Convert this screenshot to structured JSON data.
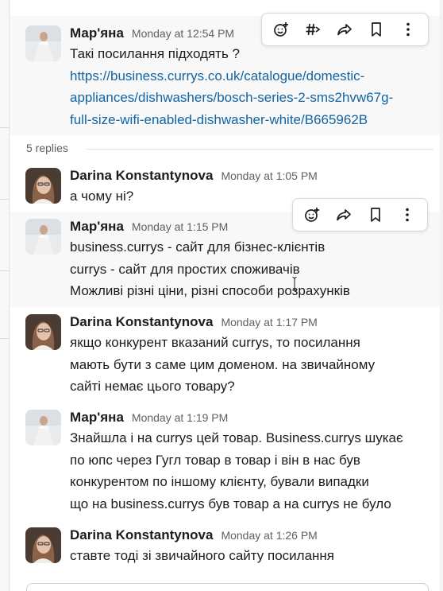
{
  "toolbar_top": {
    "actions": [
      {
        "icon": "add-reaction-icon"
      },
      {
        "icon": "hashtag-forward-icon"
      },
      {
        "icon": "share-forward-icon"
      },
      {
        "icon": "bookmark-icon"
      },
      {
        "icon": "more-vertical-icon"
      }
    ]
  },
  "toolbar_hover": {
    "actions": [
      {
        "icon": "add-reaction-icon"
      },
      {
        "icon": "share-forward-icon"
      },
      {
        "icon": "bookmark-icon"
      },
      {
        "icon": "more-vertical-icon"
      }
    ]
  },
  "parent": {
    "author": "Мар'яна",
    "time": "Monday at 12:54 PM",
    "lines": [
      "Такі посилання підходять ?"
    ],
    "link_lines": [
      "https://business.currys.co.uk/catalogue/domestic-",
      "appliances/dishwashers/bosch-series-2-sms2hvw67g-",
      "full-size-wifi-enabled-dishwasher-white/B665962B"
    ]
  },
  "replies_label": "5 replies",
  "messages": [
    {
      "author": "Darina Konstantynova",
      "time": "Monday at 1:05 PM",
      "lines": [
        "а чому ні?"
      ]
    },
    {
      "author": "Мар'яна",
      "time": "Monday at 1:15 PM",
      "lines": [
        "business.currys - сайт для бізнес-клієнтів",
        "currys - сайт для простих споживачів",
        "Можливі різні ціни, різні способи розрахунків"
      ]
    },
    {
      "author": "Darina Konstantynova",
      "time": "Monday at 1:17 PM",
      "lines": [
        "якщо конкурент вказаний currys, то посилання",
        "мають бути з саме цим доменом. на звичайному",
        "сайті немає цього товару?"
      ]
    },
    {
      "author": "Мар'яна",
      "time": "Monday at 1:19 PM",
      "lines": [
        "Знайшла і на currys цей товар. Business.currys шукає",
        "по юпс через Гугл товар в товар і він в нас був",
        "конкурентом по іншому клієнту, бували випадки",
        "що на business.currys був товар а на currys не було"
      ]
    },
    {
      "author": "Darina Konstantynova",
      "time": "Monday at 1:26 PM",
      "lines": [
        "ставте тоді зі звичайного сайту посилання"
      ]
    }
  ]
}
